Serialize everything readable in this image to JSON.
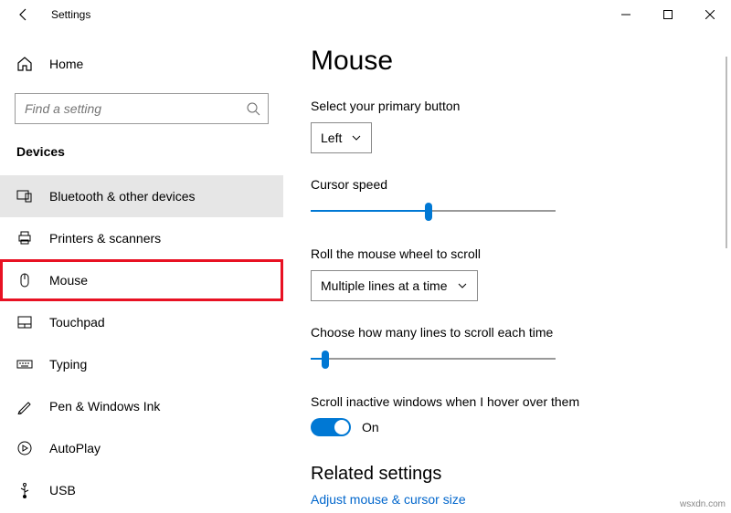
{
  "window": {
    "title": "Settings"
  },
  "sidebar": {
    "home": "Home",
    "search_placeholder": "Find a setting",
    "category": "Devices",
    "items": [
      {
        "label": "Bluetooth & other devices"
      },
      {
        "label": "Printers & scanners"
      },
      {
        "label": "Mouse"
      },
      {
        "label": "Touchpad"
      },
      {
        "label": "Typing"
      },
      {
        "label": "Pen & Windows Ink"
      },
      {
        "label": "AutoPlay"
      },
      {
        "label": "USB"
      }
    ]
  },
  "main": {
    "title": "Mouse",
    "primary_button_label": "Select your primary button",
    "primary_button_value": "Left",
    "cursor_speed_label": "Cursor speed",
    "cursor_speed_percent": 48,
    "wheel_label": "Roll the mouse wheel to scroll",
    "wheel_value": "Multiple lines at a time",
    "lines_label": "Choose how many lines to scroll each time",
    "lines_percent": 6,
    "inactive_label": "Scroll inactive windows when I hover over them",
    "inactive_state": "On",
    "related_heading": "Related settings",
    "related_link": "Adjust mouse & cursor size"
  },
  "watermark": "wsxdn.com"
}
